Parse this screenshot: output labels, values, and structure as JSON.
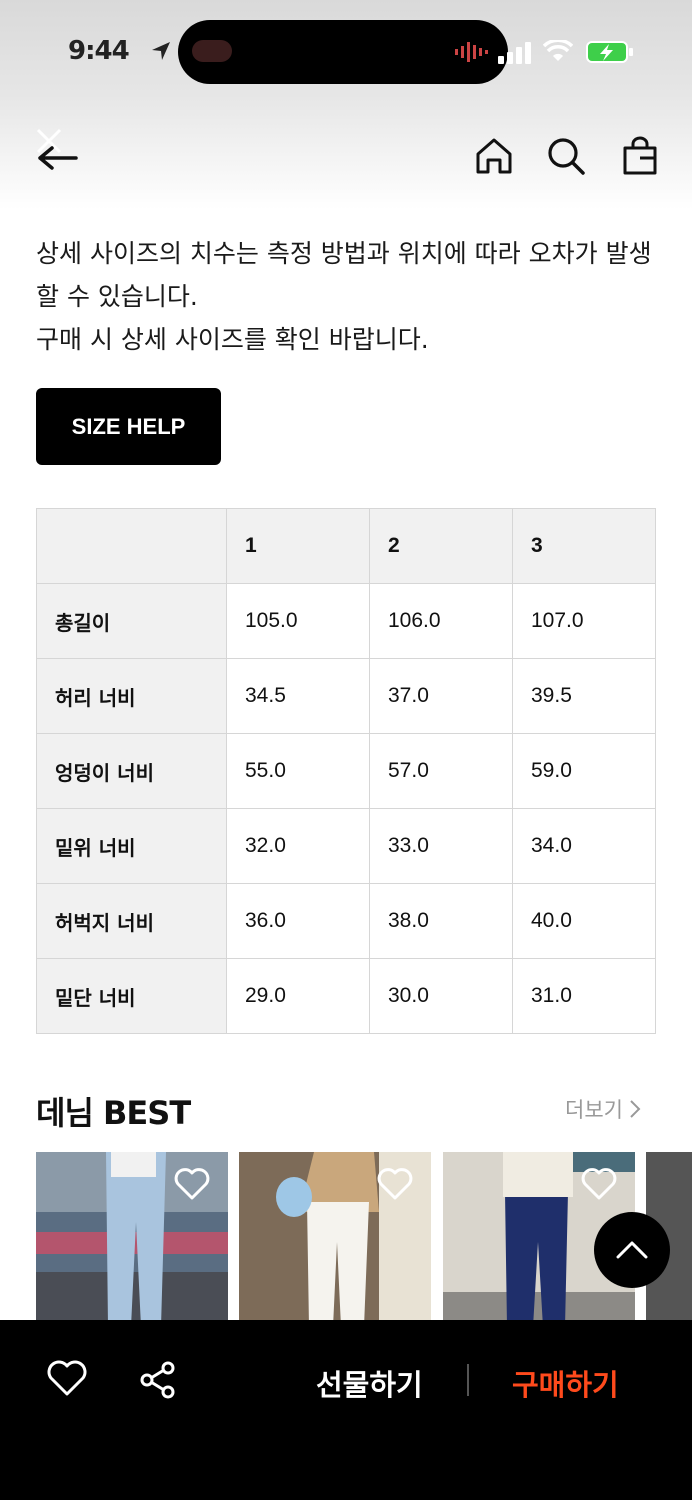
{
  "status": {
    "time": "9:44"
  },
  "notice": {
    "line1": "상세 사이즈의 치수는 측정 방법과 위치에 따라 오차가 발생할 수 있습니다.",
    "line2": "구매 시 상세 사이즈를 확인 바랍니다."
  },
  "size_help_label": "SIZE HELP",
  "size_table": {
    "headers": [
      "",
      "1",
      "2",
      "3"
    ],
    "rows": [
      {
        "label": "총길이",
        "values": [
          "105.0",
          "106.0",
          "107.0"
        ]
      },
      {
        "label": "허리 너비",
        "values": [
          "34.5",
          "37.0",
          "39.5"
        ]
      },
      {
        "label": "엉덩이 너비",
        "values": [
          "55.0",
          "57.0",
          "59.0"
        ]
      },
      {
        "label": "밑위 너비",
        "values": [
          "32.0",
          "33.0",
          "34.0"
        ]
      },
      {
        "label": "허벅지 너비",
        "values": [
          "36.0",
          "38.0",
          "40.0"
        ]
      },
      {
        "label": "밑단 너비",
        "values": [
          "29.0",
          "30.0",
          "31.0"
        ]
      }
    ]
  },
  "best": {
    "title": "데님 BEST",
    "more_label": "더보기"
  },
  "bottom_bar": {
    "gift_label": "선물하기",
    "buy_label": "구매하기"
  },
  "colors": {
    "buy_accent": "#ff4a1c",
    "bar_bg": "#000000"
  }
}
